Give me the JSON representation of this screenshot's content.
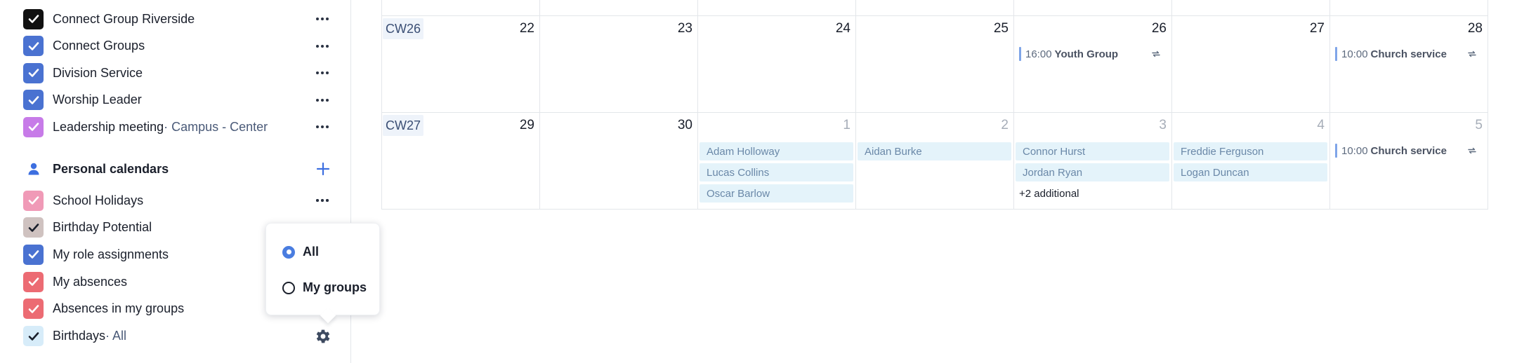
{
  "sidebar": {
    "group_calendars": [
      {
        "label": "Connect Group Riverside",
        "sub": "",
        "color": "#111111"
      },
      {
        "label": "Connect Groups",
        "sub": "",
        "color": "#4a72d1"
      },
      {
        "label": "Division Service",
        "sub": "",
        "color": "#4a72d1"
      },
      {
        "label": "Worship Leader",
        "sub": "",
        "color": "#4a72d1"
      },
      {
        "label": "Leadership meeting",
        "sub": " · Campus - Center",
        "color": "#c77be8"
      }
    ],
    "personal_section": {
      "title": "Personal calendars"
    },
    "personal_calendars": [
      {
        "label": "School Holidays",
        "sub": "",
        "color": "#f09ab7"
      },
      {
        "label": "Birthday Potential",
        "sub": "",
        "color": "#cfc2c0"
      },
      {
        "label": "My role assignments",
        "sub": "",
        "color": "#4a72d1"
      },
      {
        "label": "My absences",
        "sub": "",
        "color": "#ec6b73"
      },
      {
        "label": "Absences in my groups",
        "sub": "",
        "color": "#ec6b73"
      },
      {
        "label": "Birthdays",
        "sub": " · All",
        "color": "#d7ecf9"
      }
    ]
  },
  "popover": {
    "options": [
      {
        "label": "All",
        "selected": true
      },
      {
        "label": "My groups",
        "selected": false
      }
    ]
  },
  "calendar": {
    "weeks": [
      {
        "label": "CW26",
        "days": [
          {
            "num": "22",
            "muted": false
          },
          {
            "num": "23",
            "muted": false
          },
          {
            "num": "24",
            "muted": false
          },
          {
            "num": "25",
            "muted": false
          },
          {
            "num": "26",
            "muted": false
          },
          {
            "num": "27",
            "muted": false
          },
          {
            "num": "28",
            "muted": false
          }
        ],
        "events": [
          {
            "day": 4,
            "time": "16:00",
            "title": "Youth Group",
            "repeat": true
          },
          {
            "day": 6,
            "time": "10:00",
            "title": "Church service",
            "repeat": true
          }
        ],
        "birthdays": []
      },
      {
        "label": "CW27",
        "days": [
          {
            "num": "29",
            "muted": false
          },
          {
            "num": "30",
            "muted": false
          },
          {
            "num": "1",
            "muted": true
          },
          {
            "num": "2",
            "muted": true
          },
          {
            "num": "3",
            "muted": true
          },
          {
            "num": "4",
            "muted": true
          },
          {
            "num": "5",
            "muted": true
          }
        ],
        "events": [
          {
            "day": 6,
            "time": "10:00",
            "title": "Church service",
            "repeat": true
          }
        ],
        "birthdays": [
          {
            "day": 2,
            "names": [
              "Adam Holloway",
              "Lucas Collins",
              "Oscar Barlow"
            ],
            "more": ""
          },
          {
            "day": 3,
            "names": [
              "Aidan Burke"
            ],
            "more": ""
          },
          {
            "day": 4,
            "names": [
              "Connor Hurst",
              "Jordan Ryan"
            ],
            "more": "+2 additional"
          },
          {
            "day": 5,
            "names": [
              "Freddie Ferguson",
              "Logan Duncan"
            ],
            "more": ""
          }
        ]
      }
    ]
  }
}
